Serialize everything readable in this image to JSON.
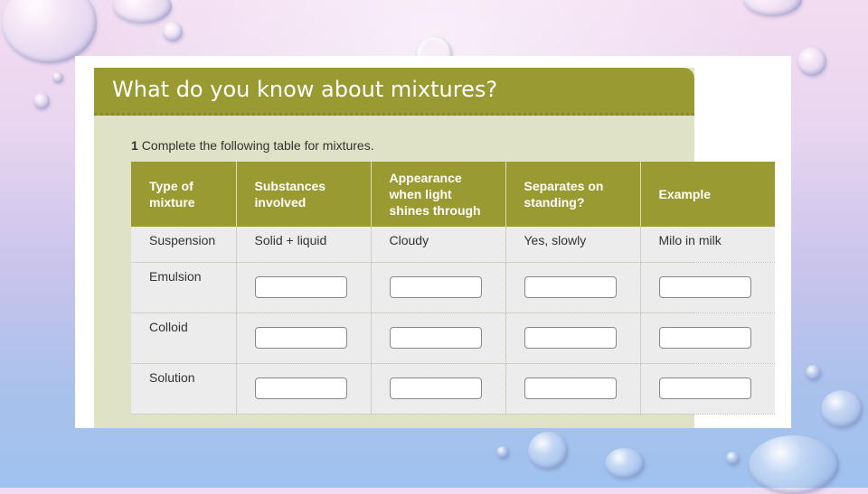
{
  "heading": {
    "title": "What do you know about mixtures?"
  },
  "instruction": {
    "number": "1",
    "text": "Complete the following table for mixtures."
  },
  "table": {
    "headers": [
      [
        "Type of",
        "mixture"
      ],
      [
        "Substances",
        "involved"
      ],
      [
        "Appearance",
        "when light",
        "shines through"
      ],
      [
        "Separates on",
        "standing?"
      ],
      [
        "Example"
      ]
    ],
    "example_row": [
      "Suspension",
      "Solid + liquid",
      "Cloudy",
      "Yes, slowly",
      "Milo in milk"
    ],
    "blank_rows": [
      "Emulsion",
      "Colloid",
      "Solution"
    ],
    "answer_value": ""
  },
  "colors": {
    "accent": "#9a9a32",
    "panel": "#e0e2c6",
    "cell": "#ececec"
  }
}
